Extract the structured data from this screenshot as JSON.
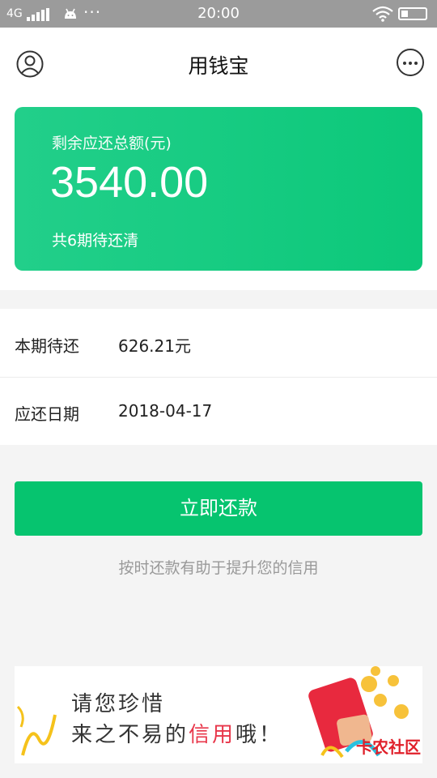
{
  "status_bar": {
    "network": "4G",
    "time": "20:00"
  },
  "header": {
    "title": "用钱宝",
    "left_icon": "user-avatar-icon",
    "right_icon": "more-dots-icon"
  },
  "summary": {
    "label": "剩余应还总额(元)",
    "amount": "3540.00",
    "periods": "共6期待还清",
    "accent_color": "#0cc87a"
  },
  "details": [
    {
      "label": "本期待还",
      "value": "626.21元"
    },
    {
      "label": "应还日期",
      "value": "2018-04-17"
    }
  ],
  "actions": {
    "repay_label": "立即还款",
    "hint": "按时还款有助于提升您的信用",
    "button_color": "#06c46f"
  },
  "banner": {
    "line1": "请您珍惜",
    "line2_prefix": "来之不易的",
    "line2_highlight": "信用",
    "line2_suffix": "哦！",
    "highlight_color": "#e8364a"
  },
  "watermark": "卡农社区"
}
